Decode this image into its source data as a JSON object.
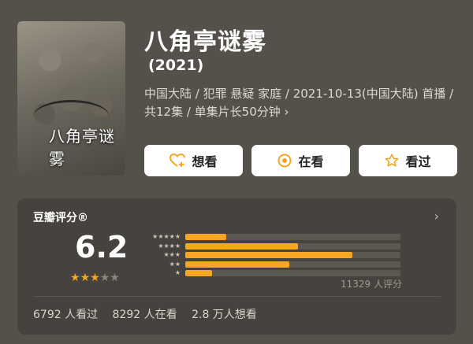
{
  "header": {
    "title": "八角亭谜雾",
    "year": "(2021)",
    "meta_line1": "中国大陆 / 犯罪 悬疑 家庭 / 2021-10-13(中国大陆) 首播 /",
    "meta_line2": "共12集 / 单集片长50分钟 ›"
  },
  "poster": {
    "title": "八角亭谜雾"
  },
  "actions": {
    "want_label": "想看",
    "watching_label": "在看",
    "watched_label": "看过"
  },
  "rating": {
    "panel_title": "豆瓣评分®",
    "score": "6.2",
    "star_value": 3,
    "star_max": 5,
    "distribution": [
      {
        "stars": 5,
        "label": "★★★★★",
        "percent": 9
      },
      {
        "stars": 4,
        "label": "★★★★",
        "percent": 25
      },
      {
        "stars": 3,
        "label": "★★★",
        "percent": 37
      },
      {
        "stars": 2,
        "label": "★★",
        "percent": 23
      },
      {
        "stars": 1,
        "label": "★",
        "percent": 6
      }
    ],
    "rating_count": "11329 人评分"
  },
  "stats": {
    "watched": "6792 人看过",
    "watching": "8292 人在看",
    "want": "2.8 万人想看"
  },
  "colors": {
    "accent": "#f5a623",
    "background": "#54504a",
    "panel": "#46423d"
  }
}
